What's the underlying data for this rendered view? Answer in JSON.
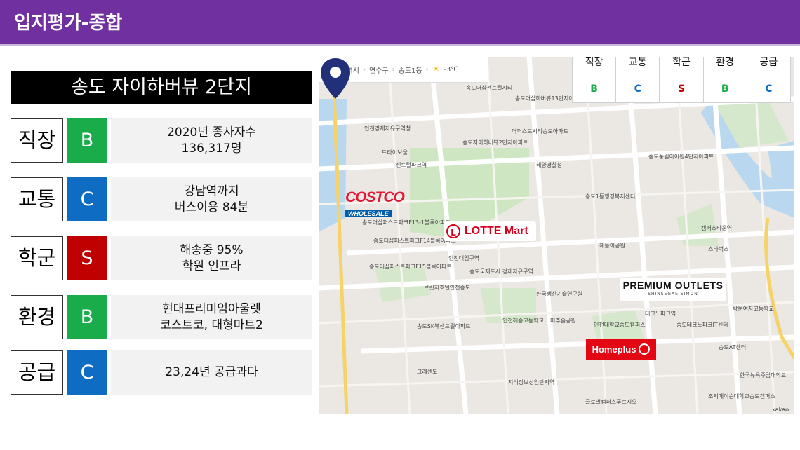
{
  "header": {
    "title": "입지평가-종합",
    "color": "#7030a0"
  },
  "complex_name": "송도 자이하버뷰 2단지",
  "grades": [
    {
      "label": "직장",
      "grade": "B",
      "color": "#1aab4b",
      "desc": [
        "2020년 종사자수",
        "136,317명"
      ]
    },
    {
      "label": "교통",
      "grade": "C",
      "color": "#0f6cc3",
      "desc": [
        "강남역까지",
        "버스이용 84분"
      ]
    },
    {
      "label": "학군",
      "grade": "S",
      "color": "#c00000",
      "desc": [
        "해송중 95%",
        "학원 인프라"
      ]
    },
    {
      "label": "환경",
      "grade": "B",
      "color": "#1aab4b",
      "desc": [
        "현대프리미엄아울렛",
        "코스트코, 대형마트2"
      ]
    },
    {
      "label": "공급",
      "grade": "C",
      "color": "#0f6cc3",
      "desc": [
        "23,24년 공급과다"
      ]
    }
  ],
  "map": {
    "breadcrumb": [
      "인천광역시",
      "연수구",
      "송도1동"
    ],
    "weather": "-3℃",
    "grade_table": {
      "headers": [
        "직장",
        "교통",
        "학군",
        "환경",
        "공급"
      ],
      "values": [
        "B",
        "C",
        "S",
        "B",
        "C"
      ],
      "colors": [
        "#1aab4b",
        "#0f6cc3",
        "#c00000",
        "#1aab4b",
        "#0f6cc3"
      ]
    },
    "brands": {
      "costco_main": "COSTCO",
      "costco_sub": "WHOLESALE",
      "lotte": "LOTTE Mart",
      "outlets": "PREMIUM OUTLETS",
      "outlets_sub": "SHINSEGAE SIMON",
      "homeplus": "Homeplus"
    },
    "places": [
      "송도더샵센트럴시티",
      "송도더샵하버뷰13단지아파트",
      "송도자이하버뷰2단지아파트",
      "더퍼스트시티송도아파트",
      "인천경제자유구역청",
      "트라이보울",
      "센트럴파크역",
      "해양경찰청",
      "송도1동행정복지센터",
      "송도풍림아이원4단지아파트",
      "송도더샵퍼스트파크F13-1블록아파트",
      "송도더샵퍼스트파크F14블록아파트",
      "인천대입구역",
      "해돋이공원",
      "송도더샵퍼스트파크F15블록아파트",
      "브릿지호텔인천송도",
      "인천해송고등학교",
      "미추홀공원",
      "한국생산기술연구원",
      "테크노파크역",
      "송도국제도시 경제자유구역",
      "인천대학교송도캠퍼스",
      "캠퍼스타운역",
      "스타벅스",
      "송도테크노파크IT센터",
      "송도AT센터",
      "박문여자고등학교",
      "조지메이슨대학교송도캠퍼스",
      "글로벌캠퍼스푸르지오",
      "크레센도",
      "지식정보산업단지역",
      "한국뉴욕주립대학교",
      "송도SK뷰센트럴아파트",
      "해송중학교"
    ],
    "attribution": "kakao"
  }
}
